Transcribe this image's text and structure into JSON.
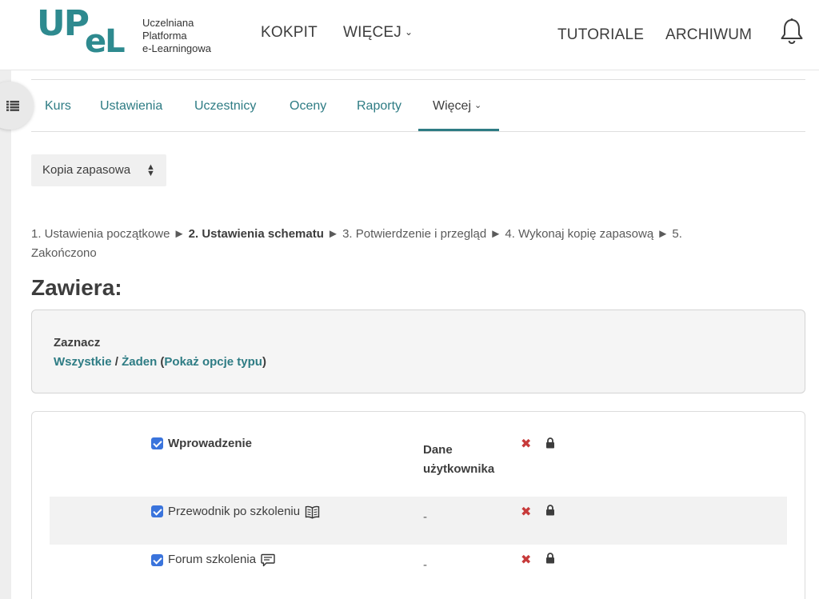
{
  "logo": {
    "mark_top": "UP",
    "mark_bottom": "eL",
    "line1": "Uczelniana",
    "line2": "Platforma",
    "line3": "e-Learningowa"
  },
  "topnav": {
    "kokpit": "KOKPIT",
    "wiecej": "WIĘCEJ",
    "tutoriale": "TUTORIALE",
    "archiwum": "ARCHIWUM"
  },
  "course_nav": {
    "items": [
      "Kurs",
      "Ustawienia",
      "Uczestnicy",
      "Oceny",
      "Raporty",
      "Więcej"
    ],
    "active": "Więcej"
  },
  "backup_menu": {
    "label": "Kopia zapasowa"
  },
  "steps": {
    "step1": "1. Ustawienia początkowe",
    "step2": "2. Ustawienia schematu",
    "step3": "3. Potwierdzenie i przegląd",
    "step4": "4. Wykonaj kopię zapasową",
    "step5_num": "5.",
    "step5": "Zakończono",
    "separator": "►"
  },
  "section_title": "Zawiera:",
  "select": {
    "label": "Zaznacz",
    "all": "Wszystkie",
    "slash": "/",
    "none": "Żaden",
    "open_paren": "(",
    "type_options": "Pokaż opcje typu",
    "close_paren": ")"
  },
  "items": {
    "section": {
      "label": "Wprowadzenie",
      "checked": true,
      "user_data_header_line1": "Dane",
      "user_data_header_line2": "użytkownika"
    },
    "rows": [
      {
        "label": "Przewodnik po szkoleniu",
        "checked": true,
        "icon": "book-icon",
        "user_data": "-"
      },
      {
        "label": "Forum szkolenia",
        "checked": true,
        "icon": "forum-icon",
        "user_data": "-"
      }
    ]
  },
  "colors": {
    "brand": "#2e8a8f",
    "link": "#2e7c84",
    "checkbox": "#3a74dc",
    "cross": "#c73a3a"
  }
}
